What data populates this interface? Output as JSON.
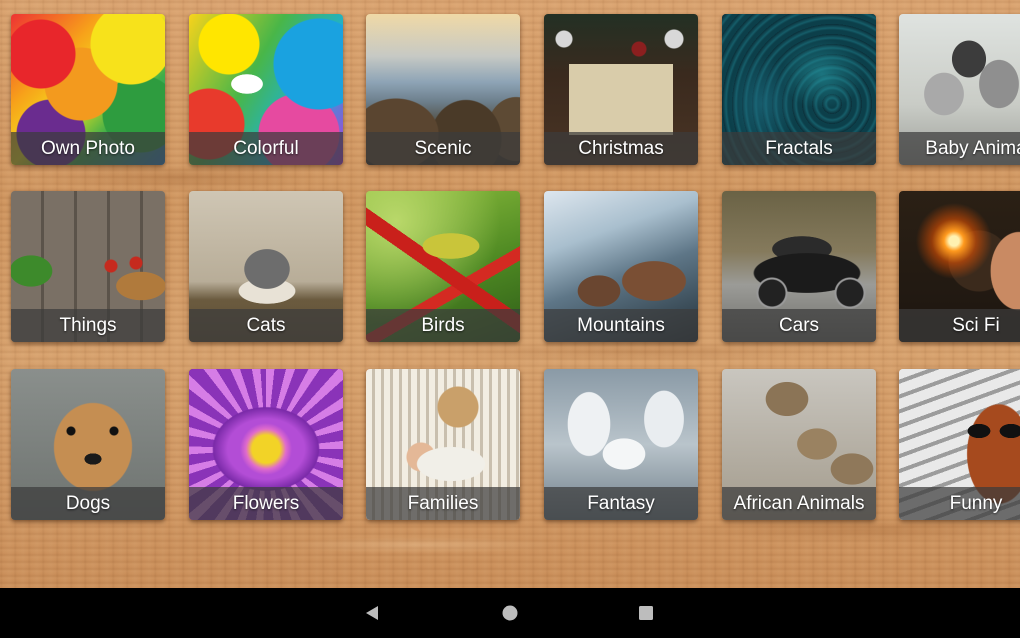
{
  "categories": [
    {
      "label": "Own Photo",
      "art": "puzzle-rainbow"
    },
    {
      "label": "Colorful",
      "art": "painted-face"
    },
    {
      "label": "Scenic",
      "art": "mountain-vista"
    },
    {
      "label": "Christmas",
      "art": "christmas-card"
    },
    {
      "label": "Fractals",
      "art": "fractal-teal"
    },
    {
      "label": "Baby Anima",
      "art": "kittens"
    },
    {
      "label": "Things",
      "art": "still-life"
    },
    {
      "label": "Cats",
      "art": "kitten-peek"
    },
    {
      "label": "Birds",
      "art": "green-bird"
    },
    {
      "label": "Mountains",
      "art": "snowy-village"
    },
    {
      "label": "Cars",
      "art": "black-sports-car"
    },
    {
      "label": "Sci Fi",
      "art": "scifi-woman"
    },
    {
      "label": "Dogs",
      "art": "puppy"
    },
    {
      "label": "Flowers",
      "art": "purple-flower"
    },
    {
      "label": "Families",
      "art": "mother-baby"
    },
    {
      "label": "Fantasy",
      "art": "pegasus"
    },
    {
      "label": "African Animals",
      "art": "meerkats"
    },
    {
      "label": "Funny",
      "art": "woman-sunglasses"
    }
  ],
  "navbar": {
    "back_icon": "back-triangle-icon",
    "home_icon": "home-circle-icon",
    "recents_icon": "recents-square-icon",
    "icon_color": "#bdbdbd"
  }
}
